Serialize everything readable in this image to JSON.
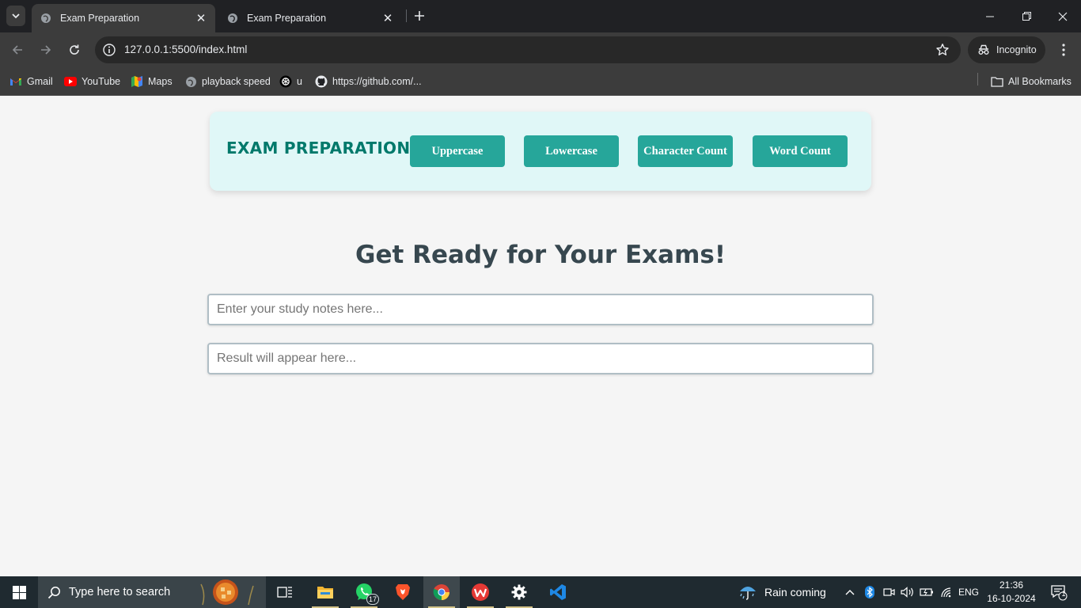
{
  "browser": {
    "tabs": [
      {
        "title": "Exam Preparation",
        "active": true
      },
      {
        "title": "Exam Preparation",
        "active": false
      }
    ],
    "url": "127.0.0.1:5500/index.html",
    "incognito_label": "Incognito",
    "bookmarks": [
      "Gmail",
      "YouTube",
      "Maps",
      "playback speed",
      "u",
      "https://github.com/..."
    ],
    "all_bookmarks_label": "All Bookmarks"
  },
  "page": {
    "brand": "EXAM PREPARATION",
    "buttons": [
      "Uppercase",
      "Lowercase",
      "Character Count",
      "Word Count"
    ],
    "hero_title": "Get Ready for Your Exams!",
    "input_placeholder": "Enter your study notes here...",
    "result_placeholder": "Result will appear here..."
  },
  "taskbar": {
    "search_placeholder": "Type here to search",
    "whatsapp_badge": "17",
    "weather": "Rain coming",
    "language": "ENG",
    "time": "21:36",
    "date": "16-10-2024",
    "notification_count": "1"
  },
  "colors": {
    "accent": "#26a69a",
    "brand": "#00796b",
    "header_bg": "#e0f7f7",
    "hero_text": "#37474f"
  }
}
